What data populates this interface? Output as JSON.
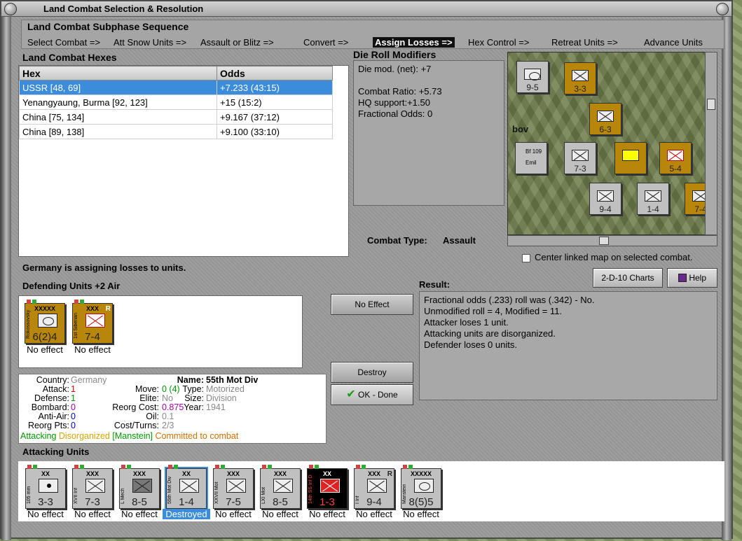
{
  "window": {
    "title": "Land Combat Selection & Resolution"
  },
  "subphase": {
    "header": "Land Combat Subphase Sequence",
    "phases": [
      "Select Combat =>",
      "Att Snow Units =>",
      "Assault or Blitz =>",
      "Convert =>",
      "Assign Losses =>",
      "Hex Control =>",
      "Retreat Units =>",
      "Advance Units"
    ],
    "active_index": 4
  },
  "hexes": {
    "header": "Land Combat Hexes",
    "columns": [
      "Hex",
      "Odds"
    ],
    "rows": [
      {
        "hex": "USSR [48, 69]",
        "odds": "+7.233 (43:15)"
      },
      {
        "hex": "Yenangyaung, Burma [92, 123]",
        "odds": "+15 (15:2)"
      },
      {
        "hex": "China [75, 134]",
        "odds": "+9.167 (37:12)"
      },
      {
        "hex": "China [89, 138]",
        "odds": "+9.100 (33:10)"
      }
    ]
  },
  "modifiers": {
    "header": "Die Roll Modifiers",
    "net": "Die mod. (net): +7",
    "ratio": "Combat Ratio: +5.73",
    "hq": "HQ support:+1.50",
    "fractional": "Fractional Odds: 0"
  },
  "combat_type": {
    "label": "Combat Type:",
    "value": "Assault"
  },
  "center_map_label": "Center linked map on selected combat.",
  "buttons": {
    "charts": "2-D-10 Charts",
    "help": "Help",
    "no_effect": "No Effect",
    "destroy": "Destroy",
    "ok": "OK - Done"
  },
  "status": "Germany is assigning losses to units.",
  "defending": {
    "header": "Defending Units +2 Air",
    "units": [
      {
        "side": "Rokossovsky",
        "size": "XXXXX",
        "val": "6(2)4",
        "caption": "No effect"
      },
      {
        "side": "1st Siberian",
        "size": "XXX",
        "tag": "R",
        "val": "7-4",
        "caption": "No effect"
      }
    ]
  },
  "result": {
    "header": "Result:",
    "lines": [
      "Fractional odds (.233) roll was (.342)  - No.",
      "Unmodified roll = 4, Modified = 11.",
      "Attacker loses 1 unit.",
      "Attacking units are disorganized.",
      "Defender loses 0 units."
    ]
  },
  "info": {
    "country_l": "Country:",
    "country": "Germany",
    "attack_l": "Attack:",
    "attack": "1",
    "defense_l": "Defense:",
    "defense": "1",
    "bombard_l": "Bombard:",
    "bombard": "0",
    "antiair_l": "Anti-Air:",
    "antiair": "0",
    "reorg_l": "Reorg Pts:",
    "reorg": "0",
    "name_l": "Name:",
    "name": "55th Mot Div",
    "move_l": "Move:",
    "move": "0 (4)",
    "type_l": "Type:",
    "type": "Motorized",
    "elite_l": "Elite:",
    "elite": "No",
    "size_l": "Size:",
    "size": "Division",
    "reorgcost_l": "Reorg Cost:",
    "reorgcost": "0.875",
    "year_l": "Year:",
    "year": "1941",
    "oil_l": "Oil:",
    "oil": "0.1",
    "cost_l": "Cost/Turns:",
    "cost": "2/3",
    "st1": "Attacking",
    "st2": "Disorganized",
    "st3": "[Manstein]",
    "st4": "Committed to combat"
  },
  "attacking": {
    "header": "Attacking Units",
    "units": [
      {
        "side": "105 mm",
        "size": "XX",
        "val": "3-3",
        "caption": "No effect"
      },
      {
        "side": "XVII Inf",
        "size": "XXX",
        "val": "7-3",
        "caption": "No effect"
      },
      {
        "side": "L Mech",
        "size": "XXX",
        "val": "8-5",
        "caption": "No effect"
      },
      {
        "side": "55th Mot Div",
        "size": "XX",
        "val": "1-4",
        "caption": "Destroyed"
      },
      {
        "side": "XXVII Mot",
        "size": "XXX",
        "val": "7-5",
        "caption": "No effect"
      },
      {
        "side": "LXI Mot",
        "size": "XXX",
        "val": "8-5",
        "caption": "No effect"
      },
      {
        "side": "14th SS Inf D",
        "size": "XX",
        "val": "1-3",
        "caption": "No effect"
      },
      {
        "side": "I Inf",
        "size": "XXX",
        "tag": "R",
        "val": "9-4",
        "caption": "No effect"
      },
      {
        "side": "Manstein",
        "size": "XXXXX",
        "val": "8(5)5",
        "caption": "No effect"
      }
    ]
  },
  "minimap": {
    "labels": [
      "9-5",
      "3-3",
      "6-3",
      "7-3",
      "5-4",
      "9-4",
      "1-4",
      "7-4",
      "bov",
      "Bf 109",
      "Emil"
    ],
    "colors": {
      "tan": "#b8860b",
      "gray": "#c0c0c0",
      "black": "#000000"
    }
  },
  "icons": [
    "window-close-icon",
    "checkmark-icon",
    "help-book-icon"
  ]
}
